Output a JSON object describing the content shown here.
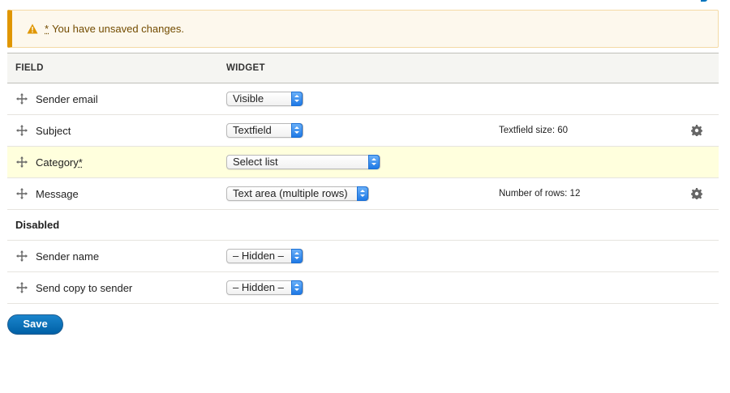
{
  "message": {
    "star": "*",
    "text": "You have unsaved changes."
  },
  "table": {
    "headers": {
      "field": "FIELD",
      "widget": "WIDGET"
    },
    "rows": [
      {
        "name": "Sender email",
        "required": "",
        "widget": "Visible",
        "summary": "",
        "has_gear": false
      },
      {
        "name": "Subject",
        "required": "",
        "widget": "Textfield",
        "summary": "Textfield size: 60",
        "has_gear": true
      },
      {
        "name": "Category",
        "required": "*",
        "widget": "Select list",
        "summary": "",
        "has_gear": false
      },
      {
        "name": "Message",
        "required": "",
        "widget": "Text area (multiple rows)",
        "summary": "Number of rows: 12",
        "has_gear": true
      }
    ],
    "disabled_region": "Disabled",
    "disabled_rows": [
      {
        "name": "Sender name",
        "widget": "– Hidden –"
      },
      {
        "name": "Send copy to sender",
        "widget": "– Hidden –"
      }
    ]
  },
  "save_label": "Save",
  "icons": {
    "warning": "warning-icon",
    "drag": "drag-handle-icon",
    "settings": "gear-icon",
    "dropdown": "select-arrows-icon"
  },
  "colors": {
    "warning_border": "#e09600",
    "warning_bg": "#fdf8ed",
    "highlight_row": "#ffffdd",
    "primary_button": "#0071b8",
    "select_arrow": "#1f79e5"
  }
}
